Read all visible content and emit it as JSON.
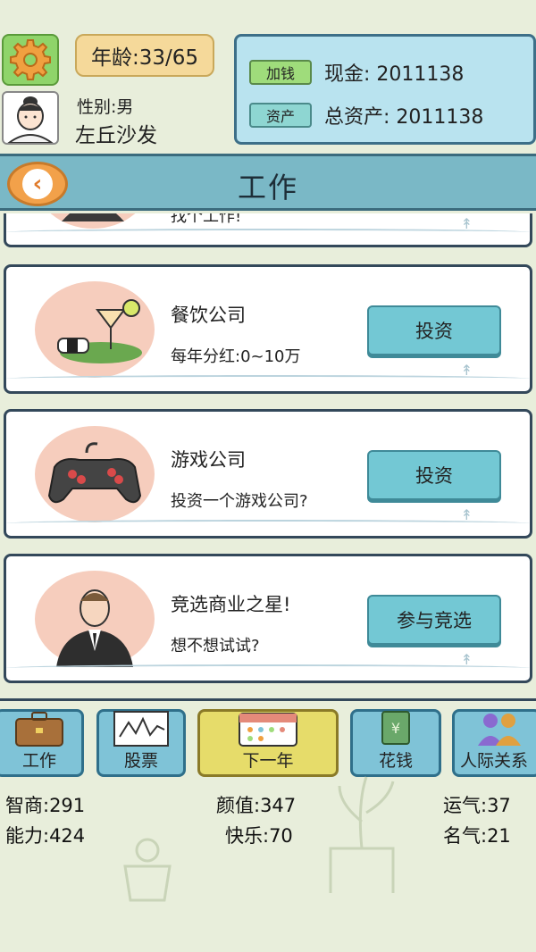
{
  "header": {
    "age_text": "年龄:33/65",
    "gender_text": "性别:男",
    "name": "左丘沙发",
    "add_money_label": "加钱",
    "cash_text": "现金: 2011138",
    "assets_label": "资产",
    "total_assets_text": "总资产: 2011138"
  },
  "page": {
    "title": "工作"
  },
  "partial_card": {
    "subtitle": "找个工作!"
  },
  "cards": [
    {
      "title": "餐饮公司",
      "subtitle": "每年分红:0~10万",
      "button": "投资"
    },
    {
      "title": "游戏公司",
      "subtitle": "投资一个游戏公司?",
      "button": "投资"
    },
    {
      "title": "竞选商业之星!",
      "subtitle": "想不想试试?",
      "button": "参与竞选"
    }
  ],
  "nav": {
    "work": "工作",
    "stocks": "股票",
    "next_year": "下一年",
    "spend": "花钱",
    "relations": "人际关系"
  },
  "stats": {
    "iq": "智商:291",
    "looks": "颜值:347",
    "luck": "运气:37",
    "ability": "能力:424",
    "happiness": "快乐:70",
    "fame": "名气:21"
  },
  "colors": {
    "background": "#e8eedb",
    "title_bar": "#7ab8c6",
    "button": "#73c8d4",
    "next_year_button": "#e6dc6a"
  }
}
